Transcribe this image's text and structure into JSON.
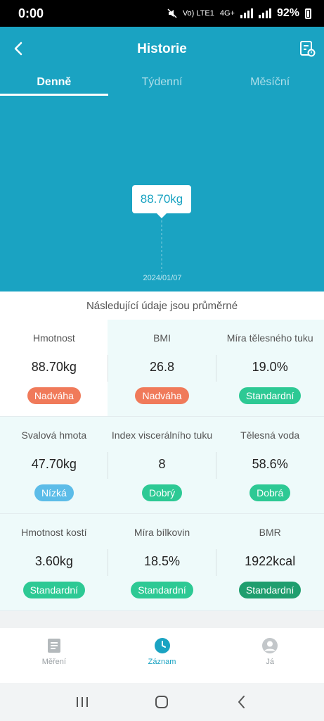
{
  "status_bar": {
    "time": "0:00",
    "network": "Vo) LTE1",
    "network2": "4G+",
    "battery": "92%"
  },
  "header": {
    "title": "Historie",
    "back_icon": "chevron-left-icon",
    "report_icon": "report-list-icon"
  },
  "tabs": [
    {
      "label": "Denně",
      "active": true
    },
    {
      "label": "Týdenní",
      "active": false
    },
    {
      "label": "Měsíční",
      "active": false
    }
  ],
  "chart_data": {
    "type": "line",
    "x": [
      "2024/01/07"
    ],
    "series": [
      {
        "values": [
          88.7
        ]
      }
    ],
    "tooltip": "88.70kg",
    "title": "",
    "xlabel": "",
    "ylabel": ""
  },
  "average_note": "Následující údaje jsou průměrné",
  "metrics": [
    [
      {
        "label": "Hmotnost",
        "value": "88.70kg",
        "status": "Nadváha",
        "status_color": "#f07a5a"
      },
      {
        "label": "BMI",
        "value": "26.8",
        "status": "Nadváha",
        "status_color": "#f07a5a"
      },
      {
        "label": "Míra tělesného tuku",
        "value": "19.0%",
        "status": "Standardní",
        "status_color": "#2dc994"
      }
    ],
    [
      {
        "label": "Svalová hmota",
        "value": "47.70kg",
        "status": "Nízká",
        "status_color": "#5cbce8"
      },
      {
        "label": "Index viscerálního tuku",
        "value": "8",
        "status": "Dobrý",
        "status_color": "#2dc994"
      },
      {
        "label": "Tělesná voda",
        "value": "58.6%",
        "status": "Dobrá",
        "status_color": "#2dc994"
      }
    ],
    [
      {
        "label": "Hmotnost kostí",
        "value": "3.60kg",
        "status": "Standardní",
        "status_color": "#2dc994"
      },
      {
        "label": "Míra bílkovin",
        "value": "18.5%",
        "status": "Standardní",
        "status_color": "#2dc994"
      },
      {
        "label": "BMR",
        "value": "1922kcal",
        "status": "Standardní",
        "status_color": "#1f9e6e"
      }
    ]
  ],
  "bottom_nav": [
    {
      "label": "Měření",
      "icon": "document-icon",
      "active": false
    },
    {
      "label": "Záznam",
      "icon": "clock-icon",
      "active": true
    },
    {
      "label": "Já",
      "icon": "user-icon",
      "active": false
    }
  ],
  "system_nav": {
    "recents": "recents-icon",
    "home": "home-icon",
    "back": "back-icon"
  }
}
